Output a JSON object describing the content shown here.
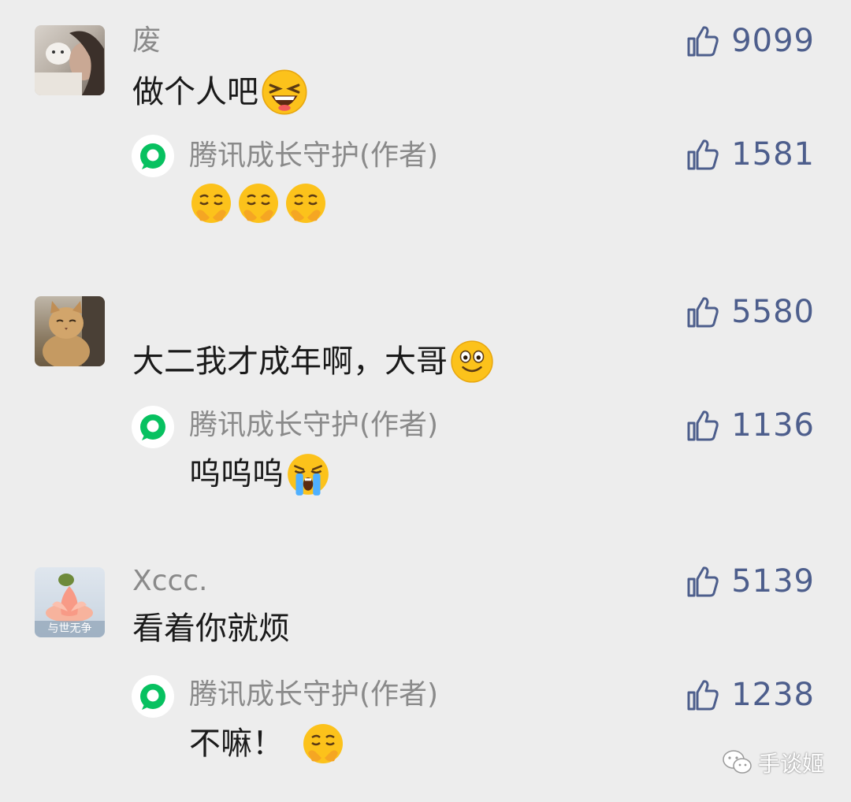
{
  "comments": [
    {
      "author": "废",
      "text": "做个人吧",
      "likes": "9099",
      "reply": {
        "author": "腾讯成长守护(作者)",
        "text": "",
        "likes": "1581"
      }
    },
    {
      "author": "",
      "text": "大二我才成年啊，大哥",
      "likes": "5580",
      "reply": {
        "author": "腾讯成长守护(作者)",
        "text": "呜呜呜",
        "likes": "1136"
      }
    },
    {
      "author": "Xccc.",
      "text": "看着你就烦",
      "likes": "5139",
      "avatar_caption": "与世无争",
      "reply": {
        "author": "腾讯成长守护(作者)",
        "text": "不嘛！",
        "likes": "1238"
      }
    }
  ],
  "watermark": "手谈姬",
  "icons": {
    "like": "thumbs-up-icon",
    "reply_author": "chat-bubble-icon",
    "emoji_laugh": "laughing-face-icon",
    "emoji_pleading": "pleading-face-icon",
    "emoji_smile": "smiling-face-icon",
    "emoji_crying": "crying-face-icon"
  },
  "colors": {
    "background": "#ededed",
    "like_count": "#4d5e8c",
    "reply_icon": "#07c160",
    "nickname": "#8a8a8a"
  }
}
